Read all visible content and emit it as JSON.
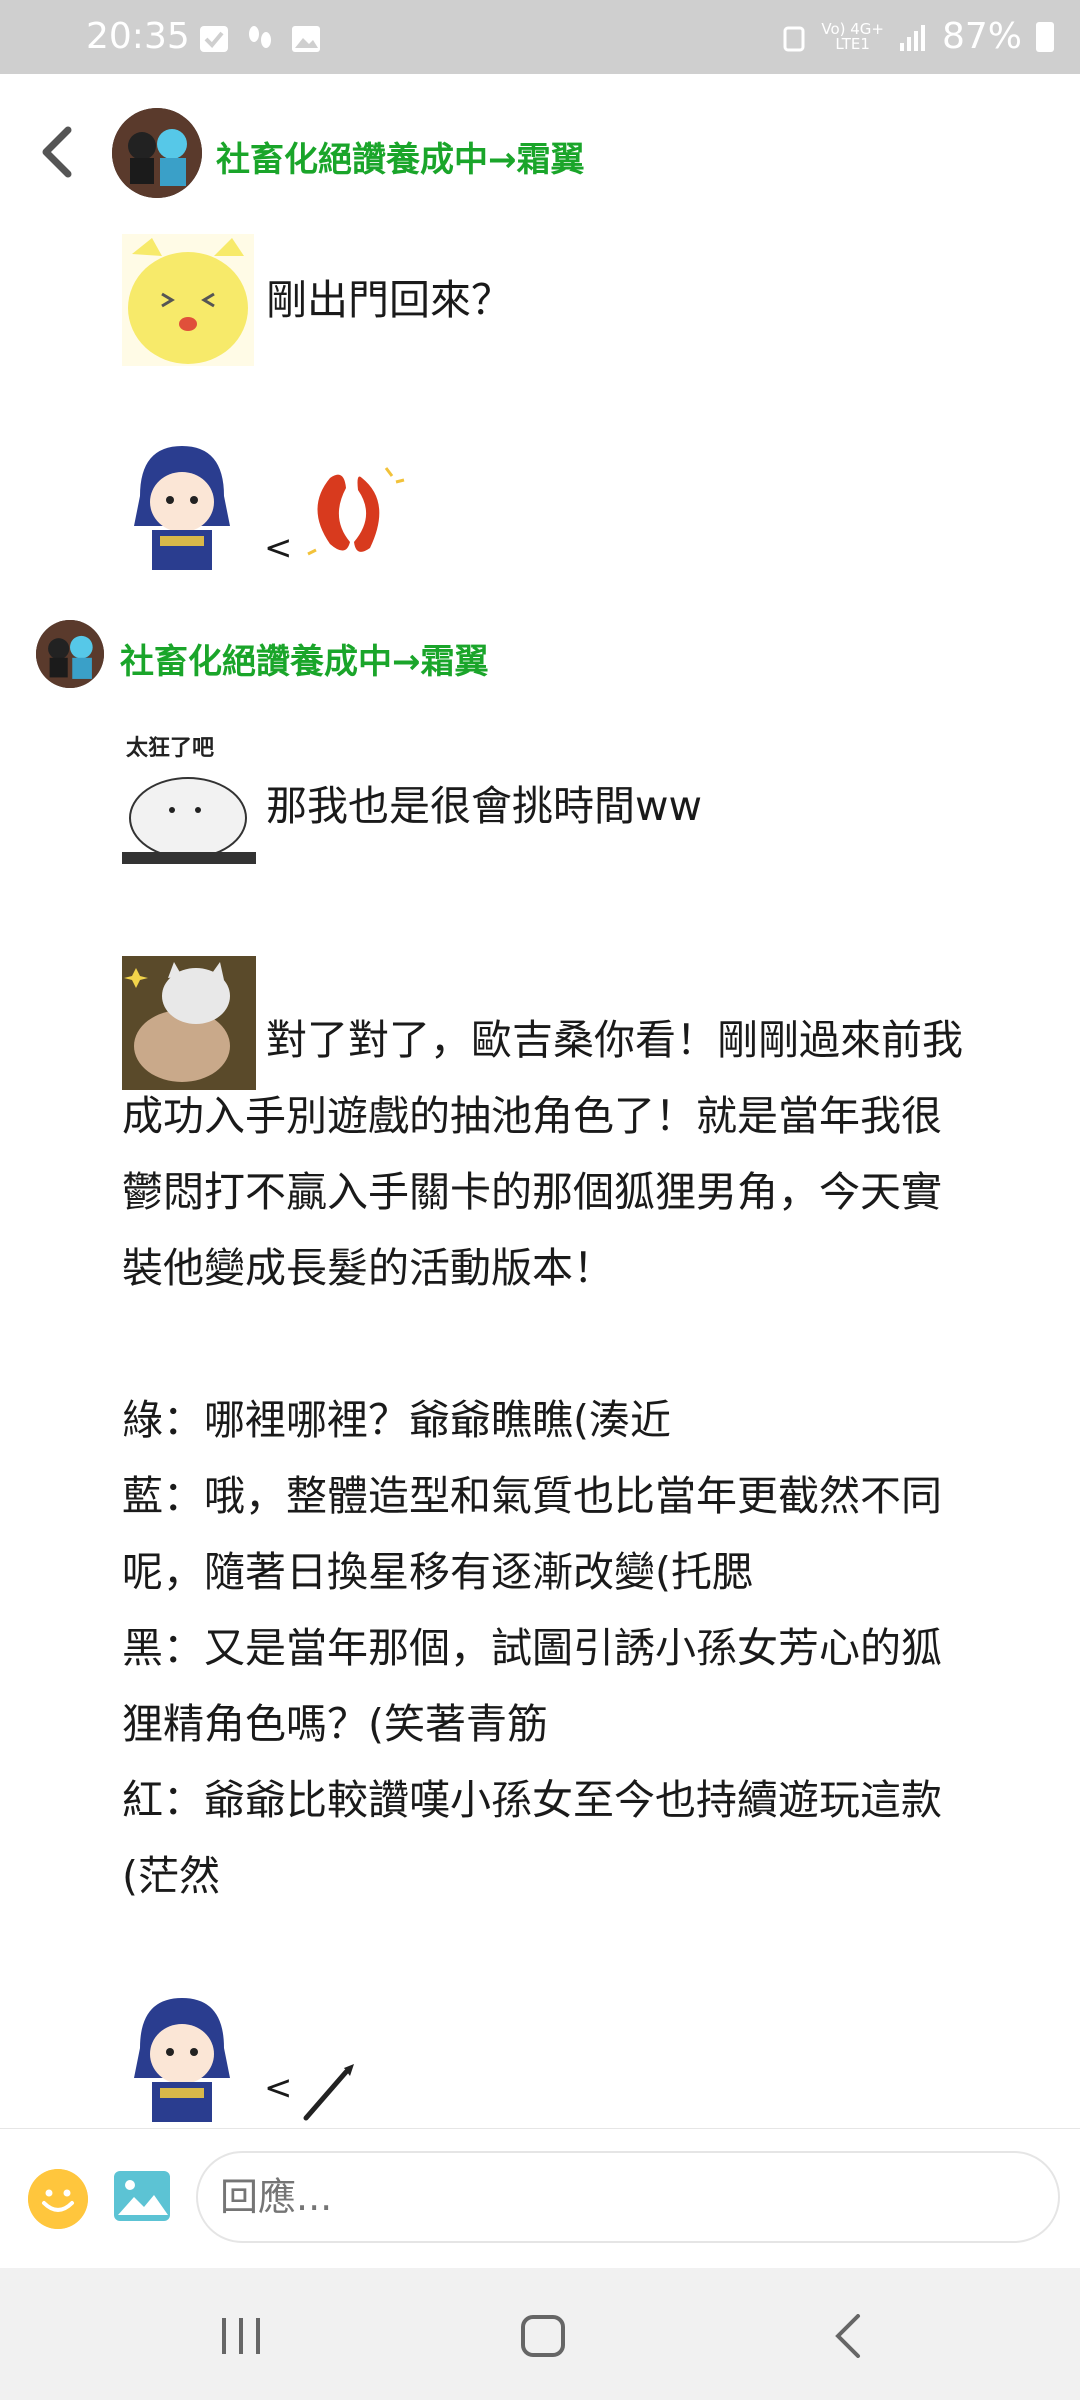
{
  "status_bar": {
    "time": "20:35",
    "network": "Vo) 4G+\nLTE1",
    "battery": "87%"
  },
  "header": {
    "title": "社畜化絕讚養成中→霜翼"
  },
  "messages": {
    "m1_text": "剛出門回來？",
    "m2_prefix": "<",
    "sender_name": "社畜化絕讚養成中→霜翼",
    "m3_text": "那我也是很會挑時間ww",
    "m3_sticker_caption": "太狂了吧",
    "m4_line1": "對了對了，歐吉桑你看！剛剛過來前我",
    "m4_line2": "成功入手別遊戲的抽池角色了！就是當年我很",
    "m4_line3": "鬱悶打不贏入手關卡的那個狐狸男角，今天實",
    "m4_line4": "裝他變成長髮的活動版本！",
    "m5_line1": "綠：哪裡哪裡？爺爺瞧瞧(湊近",
    "m5_line2": "藍：哦，整體造型和氣質也比當年更截然不同",
    "m5_line3": "呢，隨著日換星移有逐漸改變(托腮",
    "m5_line4": "黑：又是當年那個，試圖引誘小孫女芳心的狐",
    "m5_line5": "狸精角色嗎？(笑著青筋",
    "m5_line6": "紅：爺爺比較讚嘆小孫女至今也持續遊玩這款",
    "m5_line7": "(茫然",
    "m6_prefix": "<"
  },
  "reply": {
    "placeholder": "回應..."
  },
  "colors": {
    "accent_green": "#1aa52a",
    "status_bar_bg": "#cfcfcf"
  }
}
